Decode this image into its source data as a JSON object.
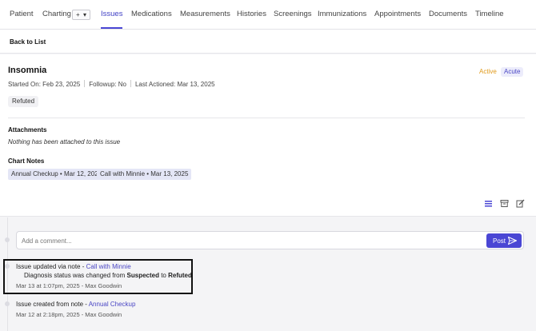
{
  "nav": {
    "tabs": [
      "Patient",
      "Charting",
      "Issues",
      "Medications",
      "Measurements",
      "Histories",
      "Screenings",
      "Immunizations",
      "Appointments",
      "Documents",
      "Timeline"
    ],
    "active_tab": "Issues",
    "plus_label": "+",
    "dropdown_caret": "▾"
  },
  "back": {
    "label": "Back to List"
  },
  "issue": {
    "title": "Insomnia",
    "badges": {
      "status": "Active",
      "severity": "Acute"
    },
    "started_on": "Started On: Feb 23, 2025",
    "followup": "Followup: No",
    "last_actioned": "Last Actioned: Mar 13, 2025",
    "diagnosis_status": "Refuted"
  },
  "attachments": {
    "heading": "Attachments",
    "empty_message": "Nothing has been attached to this issue"
  },
  "chart_notes": {
    "heading": "Chart Notes",
    "items": [
      "Annual Checkup • Mar 12, 2025",
      "Call with Minnie • Mar 13, 2025"
    ]
  },
  "comment": {
    "placeholder": "Add a comment...",
    "post_label": "Post"
  },
  "timeline": [
    {
      "prefix": "Issue updated via note - ",
      "link": "Call with Minnie",
      "detail_prefix": "Diagnosis status was changed from ",
      "detail_from": "Suspected",
      "detail_mid": " to ",
      "detail_to": "Refuted",
      "meta": "Mar 13 at 1:07pm, 2025 - Max Goodwin"
    },
    {
      "prefix": "Issue created from note - ",
      "link": "Annual Checkup",
      "meta": "Mar 12 at 2:18pm, 2025 - Max Goodwin"
    }
  ],
  "colors": {
    "accent": "#4a46d4",
    "active_badge": "#e09a1a"
  }
}
